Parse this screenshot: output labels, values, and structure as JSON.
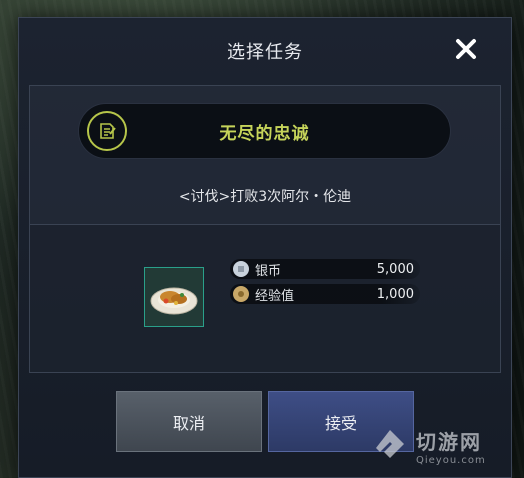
{
  "dialog": {
    "title": "选择任务",
    "close_icon": "close-icon"
  },
  "quest": {
    "icon": "quest-scroll-icon",
    "name": "无尽的忠诚",
    "description": "<讨伐>打败3次阿尔・伦迪"
  },
  "rewards": {
    "item_icon": "food-dish-icon",
    "list": [
      {
        "icon": "silver-coin-icon",
        "label": "银币",
        "value": "5,000"
      },
      {
        "icon": "exp-icon",
        "label": "经验值",
        "value": "1,000"
      }
    ]
  },
  "buttons": {
    "cancel": "取消",
    "accept": "接受"
  },
  "watermark": {
    "name": "切游网",
    "url": "Qieyou.com"
  },
  "colors": {
    "quest_name": "#c6d45a",
    "accept_button": "#2d3a66",
    "cancel_button": "#4a525c"
  }
}
